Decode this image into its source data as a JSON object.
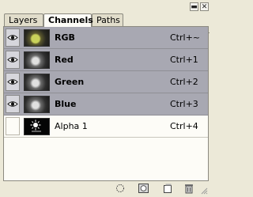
{
  "window_controls": {
    "minimize_glyph": "▬",
    "close_glyph": "✕"
  },
  "tabs": [
    {
      "label": "Layers",
      "active": false
    },
    {
      "label": "Channels",
      "active": true
    },
    {
      "label": "Paths",
      "active": false
    }
  ],
  "panel_menu_glyph": "▸",
  "channels": [
    {
      "name": "RGB",
      "shortcut": "Ctrl+~",
      "visible": true,
      "selected": true,
      "thumb": "rgb"
    },
    {
      "name": "Red",
      "shortcut": "Ctrl+1",
      "visible": true,
      "selected": true,
      "thumb": "gray"
    },
    {
      "name": "Green",
      "shortcut": "Ctrl+2",
      "visible": true,
      "selected": true,
      "thumb": "gray"
    },
    {
      "name": "Blue",
      "shortcut": "Ctrl+3",
      "visible": true,
      "selected": true,
      "thumb": "gray"
    },
    {
      "name": "Alpha 1",
      "shortcut": "Ctrl+4",
      "visible": false,
      "selected": false,
      "thumb": "alpha"
    }
  ],
  "bottom_icons": [
    "load-selection-icon",
    "save-selection-icon",
    "new-channel-icon",
    "delete-channel-icon"
  ],
  "colors": {
    "selected_row": "#a8a8b2",
    "panel_bg": "#fdfcf7",
    "chrome_bg": "#ece9d8"
  }
}
